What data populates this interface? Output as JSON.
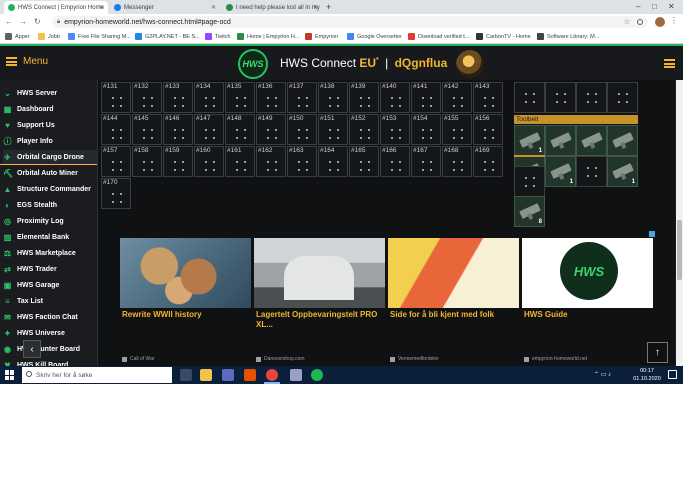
{
  "browser": {
    "tabs": [
      {
        "title": "HWS Connect | Empyrion Home",
        "active": true,
        "color": "#1fb35a"
      },
      {
        "title": "Messenger",
        "active": false,
        "color": "#1877f2"
      },
      {
        "title": "I need help please lost all in my",
        "active": false,
        "color": "#2a8c4a"
      }
    ],
    "url": "empyrion-homeworld.net/hws-connect.html#page-ocd",
    "bookmarks": [
      "Apper",
      "Jobb",
      "Free File Sharing M...",
      "G2PLAY.NET - BE S...",
      "Twitch",
      "Home | Empyrion H...",
      "Empyrion",
      "Google Oversetter",
      "Download verified t...",
      "CarbonTV - Home",
      "Software Library: M..."
    ]
  },
  "header": {
    "menu_label": "Menu",
    "logo_text": "HWS",
    "title": "HWS Connect",
    "region": "EU",
    "region_mark": "*",
    "separator": "|",
    "username": "dQgnflua"
  },
  "sidebar": {
    "items": [
      {
        "label": "HWS Server",
        "icon": "chevron-down-icon",
        "active": false
      },
      {
        "label": "Dashboard",
        "icon": "dashboard-icon",
        "active": false
      },
      {
        "label": "Support Us",
        "icon": "support-icon",
        "active": false
      },
      {
        "label": "Player Info",
        "icon": "info-icon",
        "active": false
      },
      {
        "label": "Orbital Cargo Drone",
        "icon": "drone-icon",
        "active": true
      },
      {
        "label": "Orbital Auto Miner",
        "icon": "miner-icon",
        "active": false
      },
      {
        "label": "Structure Commander",
        "icon": "structure-icon",
        "active": false
      },
      {
        "label": "EGS Stealth",
        "icon": "stealth-icon",
        "active": false
      },
      {
        "label": "Proximity Log",
        "icon": "proximity-icon",
        "active": false
      },
      {
        "label": "Elemental Bank",
        "icon": "bank-icon",
        "active": false
      },
      {
        "label": "HWS Marketplace",
        "icon": "marketplace-icon",
        "active": false
      },
      {
        "label": "HWS Trader",
        "icon": "trader-icon",
        "active": false
      },
      {
        "label": "HWS Garage",
        "icon": "garage-icon",
        "active": false
      },
      {
        "label": "Tax List",
        "icon": "list-icon",
        "active": false
      },
      {
        "label": "HWS Faction Chat",
        "icon": "chat-icon",
        "active": false
      },
      {
        "label": "HWS Universe",
        "icon": "universe-icon",
        "active": false
      },
      {
        "label": "HWS Hunter Board",
        "icon": "hunter-icon",
        "active": false
      },
      {
        "label": "HWS Kill Board",
        "icon": "kill-icon",
        "active": false
      }
    ]
  },
  "inventory": {
    "rows": [
      [
        "#131",
        "#132",
        "#133",
        "#134",
        "#135",
        "#136",
        "#137",
        "#138",
        "#139",
        "#140",
        "#141",
        "#142",
        "#143"
      ],
      [
        "#144",
        "#145",
        "#146",
        "#147",
        "#148",
        "#149",
        "#150",
        "#151",
        "#152",
        "#153",
        "#154",
        "#155",
        "#156"
      ],
      [
        "#157",
        "#158",
        "#159",
        "#160",
        "#161",
        "#162",
        "#163",
        "#164",
        "#165",
        "#166",
        "#167",
        "#168",
        "#169"
      ],
      [
        "#170"
      ]
    ]
  },
  "toolbelt": {
    "label": "Toolbelt",
    "counts": [
      "1",
      "1",
      "1",
      "1",
      "8"
    ]
  },
  "ads": [
    {
      "headline": "Rewrite WWII history",
      "source": "Call of War",
      "icon": "map-image"
    },
    {
      "headline": "Lagertelt Oppbevaringstelt PRO XL...",
      "source": "Danovershop.com",
      "icon": "tent-image"
    },
    {
      "headline": "Side for å bli kjent med folk",
      "source": "Vennemedfordeler",
      "icon": "woman-image"
    },
    {
      "headline": "HWS Guide",
      "source": "empyrion-homeworld.net",
      "icon": "hws-logo-image"
    }
  ],
  "taskbar": {
    "search_placeholder": "Skriv her for å søke",
    "time": "00:17",
    "date": "01.10.2020"
  }
}
